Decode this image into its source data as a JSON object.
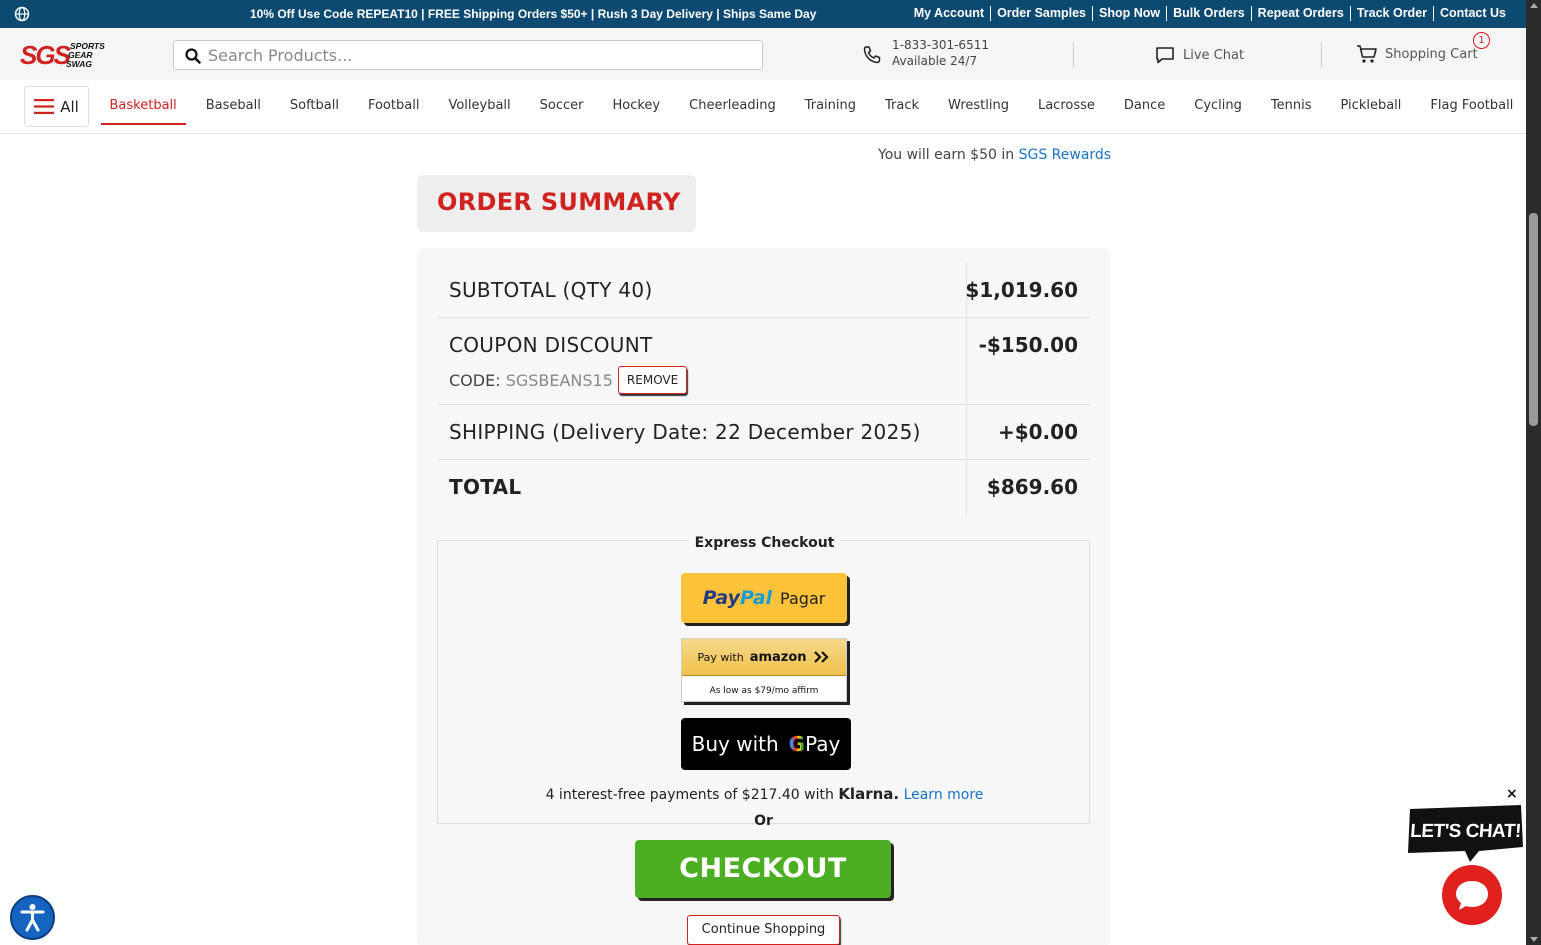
{
  "topbar": {
    "promo": "10% Off Use Code REPEAT10 | FREE Shipping Orders $50+ | Rush 3 Day Delivery | Ships Same Day",
    "links": [
      "My Account",
      "Order Samples",
      "Shop Now",
      "Bulk Orders",
      "Repeat Orders",
      "Track Order",
      "Contact Us"
    ]
  },
  "header": {
    "logo_text": "SGS SPORTS GEAR SWAG",
    "search_placeholder": "Search Products...",
    "phone": "1-833-301-6511",
    "phone_hours": "Available 24/7",
    "live_chat": "Live Chat",
    "cart_label": "Shopping Cart",
    "cart_count": "1"
  },
  "nav": {
    "all_label": "All",
    "items": [
      "Basketball",
      "Baseball",
      "Softball",
      "Football",
      "Volleyball",
      "Soccer",
      "Hockey",
      "Cheerleading",
      "Training",
      "Track",
      "Wrestling",
      "Lacrosse",
      "Dance",
      "Cycling",
      "Tennis",
      "Pickleball",
      "Flag Football"
    ],
    "active": "Basketball"
  },
  "rewards": {
    "prefix": "You will earn $50 in",
    "link": "SGS Rewards"
  },
  "summary": {
    "title": "ORDER SUMMARY",
    "subtotal_label": "SUBTOTAL (QTY 40)",
    "subtotal_value": "$1,019.60",
    "coupon_label": "COUPON DISCOUNT",
    "coupon_code_prefix": "CODE:",
    "coupon_code": "SGSBEANS15",
    "remove_label": "REMOVE",
    "coupon_value": "-$150.00",
    "shipping_label": "SHIPPING (Delivery Date: 22 December 2025)",
    "shipping_value": "+$0.00",
    "total_label": "TOTAL",
    "total_value": "$869.60"
  },
  "express": {
    "title": "Express Checkout",
    "paypal_pay": "Pay",
    "paypal_pal": "Pal",
    "paypal_action": "Pagar",
    "amazon_prefix": "Pay with",
    "amazon_brand": "amazon",
    "affirm_text": "As low as $79/mo affirm",
    "gpay_prefix": "Buy with",
    "gpay_g": "G",
    "gpay_pay": "Pay",
    "klarna_text": "4 interest-free payments of $217.40 with",
    "klarna_brand": "Klarna.",
    "klarna_link": "Learn more"
  },
  "actions": {
    "or": "Or",
    "checkout": "CHECKOUT",
    "continue": "Continue Shopping"
  },
  "chat": {
    "bubble": "LET'S CHAT!",
    "close": "×"
  },
  "colors": {
    "topbar": "#0d4a72",
    "brand_red": "#d0221f",
    "checkout_green": "#4caf23",
    "paypal_yellow": "#fcc23a",
    "link_blue": "#1a73c6"
  }
}
